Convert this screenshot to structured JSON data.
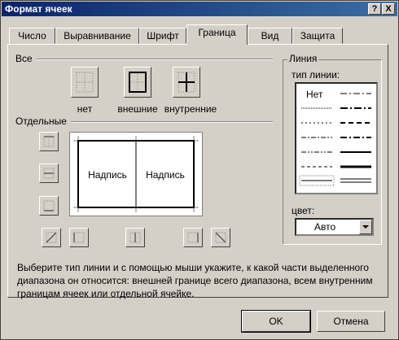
{
  "window": {
    "title": "Формат ячеек",
    "help_label": "?",
    "close_label": "X"
  },
  "tabs": [
    {
      "label": "Число"
    },
    {
      "label": "Выравнивание"
    },
    {
      "label": "Шрифт"
    },
    {
      "label": "Граница",
      "active": true
    },
    {
      "label": "Вид"
    },
    {
      "label": "Защита"
    }
  ],
  "presets": {
    "group_label": "Все",
    "none_label": "нет",
    "outline_label": "внешние",
    "inside_label": "внутренние"
  },
  "border": {
    "group_label": "Отдельные",
    "preview_text_left": "Надпись",
    "preview_text_right": "Надпись"
  },
  "line": {
    "group_label": "Линия",
    "style_label": "тип линии:",
    "none_style_label": "Нет",
    "color_label": "цвет:",
    "color_value": "Авто"
  },
  "description": "Выберите тип линии и с помощью мыши укажите, к какой части выделенного диапазона он относится: внешней границе всего диапазона, всем внутренним границам ячеек или отдельной ячейке.",
  "buttons": {
    "ok_label": "OK",
    "cancel_label": "Отмена"
  },
  "colors": {
    "title_bar_start": "#0a246a",
    "title_bar_end": "#3a6ea5",
    "face": "#d4d0c8"
  }
}
